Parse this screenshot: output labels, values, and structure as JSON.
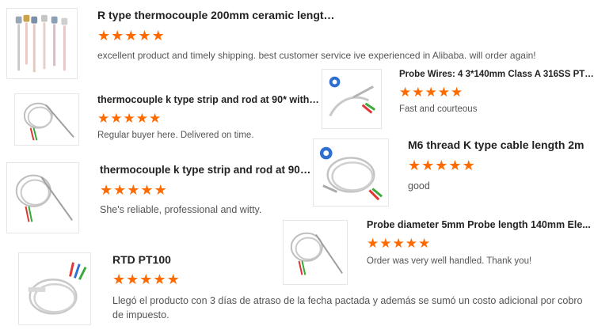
{
  "colors": {
    "star": "#ff6a00",
    "title": "#222222",
    "comment": "#555555",
    "border": "#e6e6e6"
  },
  "reviews": [
    {
      "title": "R type thermocouple 200mm ceramic length a...",
      "rating": 5,
      "comment": "excellent product and timely shipping. best customer service ive experienced in Alibaba. will order again!",
      "image_icon": "ceramic-thermocouples-image"
    },
    {
      "title": "Probe Wires: 4 3*140mm Class A 316SS PTFE",
      "rating": 5,
      "comment": "Fast and courteous",
      "image_icon": "probe-cable-with-logo-image"
    },
    {
      "title": "thermocouple k type strip and rod at 90* with 3...",
      "rating": 5,
      "comment": "Regular buyer here. Delivered on time.",
      "image_icon": "coiled-probe-image"
    },
    {
      "title": "M6 thread K type cable length 2m",
      "rating": 5,
      "comment": "good",
      "image_icon": "coiled-cable-with-logo-image"
    },
    {
      "title": "thermocouple k type strip and rod at 90* with 3...",
      "rating": 5,
      "comment": "She's reliable, professional and witty.",
      "image_icon": "coiled-probe-image"
    },
    {
      "title": "Probe diameter 5mm Probe length 140mm Ele...",
      "rating": 5,
      "comment": "Order was very well handled. Thank you!",
      "image_icon": "coiled-probe-image"
    },
    {
      "title": "RTD PT100",
      "rating": 5,
      "comment": "Llegó el producto con 3 días de atraso de la fecha pactada y además se sumó un costo adicional por cobro de impuesto.",
      "image_icon": "rtd-probe-image"
    }
  ]
}
